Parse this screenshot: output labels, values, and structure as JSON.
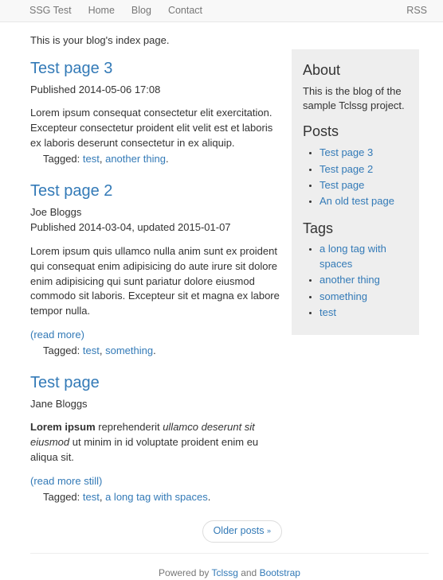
{
  "navbar": {
    "brand": "SSG Test",
    "links": [
      {
        "label": "Home"
      },
      {
        "label": "Blog"
      },
      {
        "label": "Contact"
      }
    ],
    "right_link": "RSS"
  },
  "main": {
    "intro": "This is your blog's index page.",
    "posts": [
      {
        "title": "Test page 3",
        "author": "",
        "published": "Published 2014-05-06 17:08",
        "body_plain": "Lorem ipsum consequat consectetur elit exercitation. Excepteur consectetur proident elit velit est et laboris ex laboris deserunt consectetur in ex aliquip.",
        "read_more": "",
        "tagged_label": "Tagged:",
        "tags": [
          "test",
          "another thing"
        ]
      },
      {
        "title": "Test page 2",
        "author": "Joe Bloggs",
        "published": "Published 2014-03-04, updated 2015-01-07",
        "body_plain": "Lorem ipsum quis ullamco nulla anim sunt ex proident qui consequat enim adipisicing do aute irure sit dolore enim adipisicing qui sunt pariatur dolore eiusmod commodo sit laboris. Excepteur sit et magna ex labore tempor nulla.",
        "read_more": "(read more)",
        "tagged_label": "Tagged:",
        "tags": [
          "test",
          "something"
        ]
      },
      {
        "title": "Test page",
        "author": "Jane Bloggs",
        "published": "",
        "body_bold": "Lorem ipsum",
        "body_mid": " reprehenderit ",
        "body_italic": "ullamco deserunt sit eiusmod",
        "body_tail": " ut minim in id voluptate proident enim eu aliqua sit.",
        "read_more": "(read more still)",
        "tagged_label": "Tagged:",
        "tags": [
          "test",
          "a long tag with spaces"
        ]
      }
    ],
    "pager": {
      "older_label": "Older posts",
      "chevron": "»"
    }
  },
  "sidebar": {
    "about_heading": "About",
    "about_text": "This is the blog of the sample Tclssg project.",
    "posts_heading": "Posts",
    "posts": [
      {
        "label": "Test page 3"
      },
      {
        "label": "Test page 2"
      },
      {
        "label": "Test page"
      },
      {
        "label": "An old test page"
      }
    ],
    "tags_heading": "Tags",
    "tags": [
      {
        "label": "a long tag with spaces"
      },
      {
        "label": "another thing"
      },
      {
        "label": "something"
      },
      {
        "label": "test"
      }
    ]
  },
  "footer": {
    "prefix": "Powered by ",
    "link1": "Tclssg",
    "middle": " and ",
    "link2": "Bootstrap"
  },
  "colors": {
    "link": "#337ab7",
    "navbar_bg": "#f8f8f8",
    "navbar_text": "#777777",
    "sidebar_bg": "#eeeeee",
    "body_text": "#333333"
  }
}
